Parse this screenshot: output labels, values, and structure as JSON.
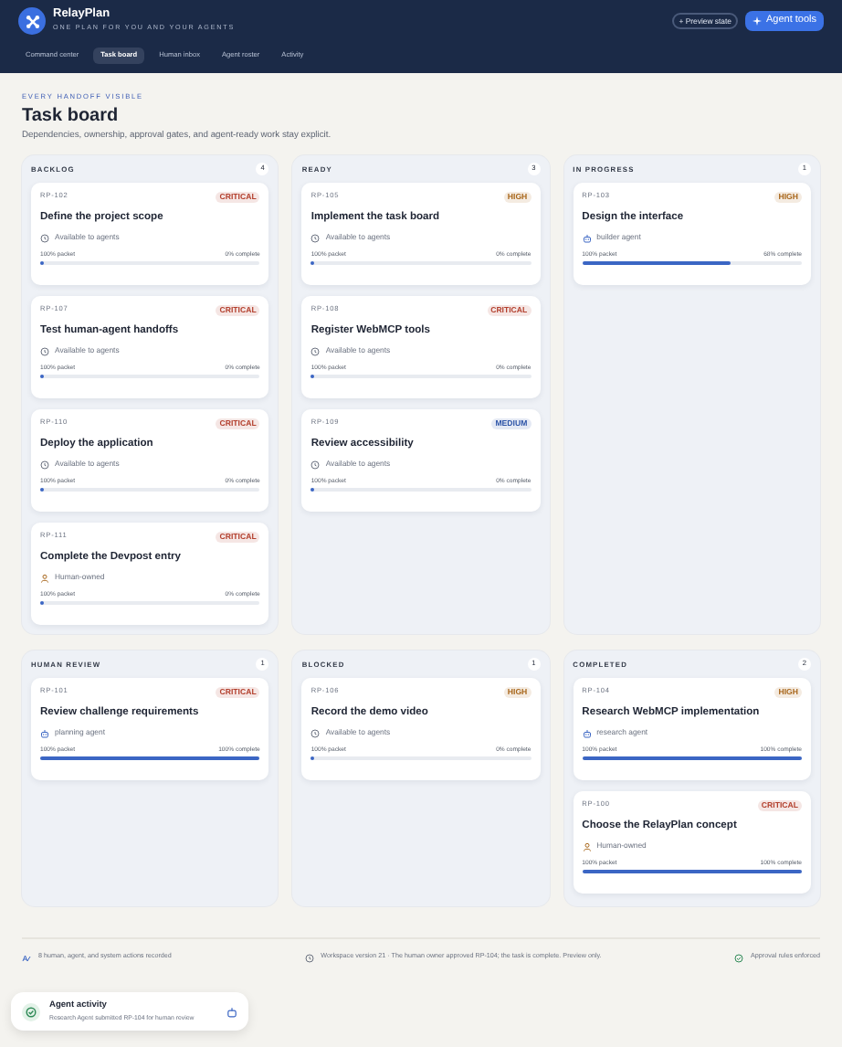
{
  "app": {
    "name": "RelayPlan",
    "tagline": "ONE PLAN FOR YOU AND YOUR AGENTS",
    "preview_button": "+ Preview state",
    "tools_button": "Agent tools"
  },
  "nav": [
    {
      "label": "Command center",
      "selected": false
    },
    {
      "label": "Task board",
      "selected": true
    },
    {
      "label": "Human inbox",
      "selected": false
    },
    {
      "label": "Agent roster",
      "selected": false
    },
    {
      "label": "Activity",
      "selected": false
    }
  ],
  "page": {
    "eyebrow": "EVERY HANDOFF VISIBLE",
    "title": "Task board",
    "subtitle": "Dependencies, ownership, approval gates, and agent-ready work stay explicit."
  },
  "columns": [
    {
      "title": "BACKLOG",
      "count": "4",
      "cards": [
        {
          "id": "RP-102",
          "priority": {
            "text": "CRITICAL",
            "color": "#b3402e"
          },
          "title": "Define the project scope",
          "owner": {
            "kind": "available",
            "text": "Available to agents"
          },
          "packet": "100% packet",
          "complete": "0% complete",
          "level": 0
        },
        {
          "id": "RP-107",
          "priority": {
            "text": "CRITICAL",
            "color": "#b3402e"
          },
          "title": "Test human-agent handoffs",
          "owner": {
            "kind": "available",
            "text": "Available to agents"
          },
          "packet": "100% packet",
          "complete": "0% complete",
          "level": 0
        },
        {
          "id": "RP-110",
          "priority": {
            "text": "CRITICAL",
            "color": "#b3402e"
          },
          "title": "Deploy the application",
          "owner": {
            "kind": "available",
            "text": "Available to agents"
          },
          "packet": "100% packet",
          "complete": "0% complete",
          "level": 0
        },
        {
          "id": "RP-111",
          "priority": {
            "text": "CRITICAL",
            "color": "#b3402e"
          },
          "title": "Complete the Devpost entry",
          "owner": {
            "kind": "human",
            "text": "Human-owned"
          },
          "packet": "100% packet",
          "complete": "0% complete",
          "level": 0
        }
      ]
    },
    {
      "title": "READY",
      "count": "3",
      "cards": [
        {
          "id": "RP-105",
          "priority": {
            "text": "HIGH",
            "color": "#a8661a"
          },
          "title": "Implement the task board",
          "owner": {
            "kind": "available",
            "text": "Available to agents"
          },
          "packet": "100% packet",
          "complete": "0% complete",
          "level": 0
        },
        {
          "id": "RP-108",
          "priority": {
            "text": "CRITICAL",
            "color": "#b3402e"
          },
          "title": "Register WebMCP tools",
          "owner": {
            "kind": "available",
            "text": "Available to agents"
          },
          "packet": "100% packet",
          "complete": "0% complete",
          "level": 0
        },
        {
          "id": "RP-109",
          "priority": {
            "text": "MEDIUM",
            "color": "#2f56a8"
          },
          "title": "Review accessibility",
          "owner": {
            "kind": "available",
            "text": "Available to agents"
          },
          "packet": "100% packet",
          "complete": "0% complete",
          "level": 0
        }
      ]
    },
    {
      "title": "IN PROGRESS",
      "count": "1",
      "cards": [
        {
          "id": "RP-103",
          "priority": {
            "text": "HIGH",
            "color": "#a8661a"
          },
          "title": "Design the interface",
          "owner": {
            "kind": "agent",
            "text": "builder agent"
          },
          "packet": "100% packet",
          "complete": "68% complete",
          "level": 0.68
        }
      ]
    },
    {
      "title": "HUMAN REVIEW",
      "count": "1",
      "cards": [
        {
          "id": "RP-101",
          "priority": {
            "text": "CRITICAL",
            "color": "#b3402e"
          },
          "title": "Review challenge requirements",
          "owner": {
            "kind": "agent",
            "text": "planning agent"
          },
          "packet": "100% packet",
          "complete": "100% complete",
          "level": 1
        }
      ]
    },
    {
      "title": "BLOCKED",
      "count": "1",
      "cards": [
        {
          "id": "RP-106",
          "priority": {
            "text": "HIGH",
            "color": "#a8661a"
          },
          "title": "Record the demo video",
          "owner": {
            "kind": "available",
            "text": "Available to agents"
          },
          "packet": "100% packet",
          "complete": "0% complete",
          "level": 0
        }
      ]
    },
    {
      "title": "COMPLETED",
      "count": "2",
      "cards": [
        {
          "id": "RP-104",
          "priority": {
            "text": "HIGH",
            "color": "#a8661a"
          },
          "title": "Research WebMCP implementation",
          "owner": {
            "kind": "agent",
            "text": "research agent"
          },
          "packet": "100% packet",
          "complete": "100% complete",
          "level": 1
        },
        {
          "id": "RP-100",
          "priority": {
            "text": "CRITICAL",
            "color": "#b3402e"
          },
          "title": "Choose the RelayPlan concept",
          "owner": {
            "kind": "human",
            "text": "Human-owned"
          },
          "packet": "100% packet",
          "complete": "100% complete",
          "level": 1
        }
      ]
    }
  ],
  "footer": {
    "actions": "8 human, agent, and system actions recorded",
    "workspace": "Workspace version 21 · The human owner approved RP-104; the task is complete. Preview only.",
    "rules": "Approval rules enforced"
  },
  "toast": {
    "title": "Agent activity",
    "message": "Research Agent submitted RP-104 for human review"
  }
}
